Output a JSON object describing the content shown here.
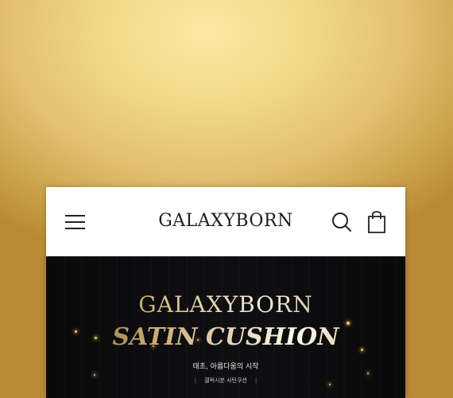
{
  "header": {
    "brand": "GALAXYBORN"
  },
  "hero": {
    "title": "GALAXYBORN",
    "subtitle": "SATIN CUSHION",
    "tagline": "태초, 아름다움의 시작",
    "product_name": "갤럭시본 사틴쿠션"
  },
  "icons": {
    "menu": "hamburger-menu-icon",
    "search": "search-icon",
    "bag": "shopping-bag-icon"
  },
  "colors": {
    "background_gold": "#f2d98a",
    "hero_black": "#0a0a0b",
    "header_white": "#ffffff",
    "text_dark": "#1c1c1c"
  }
}
